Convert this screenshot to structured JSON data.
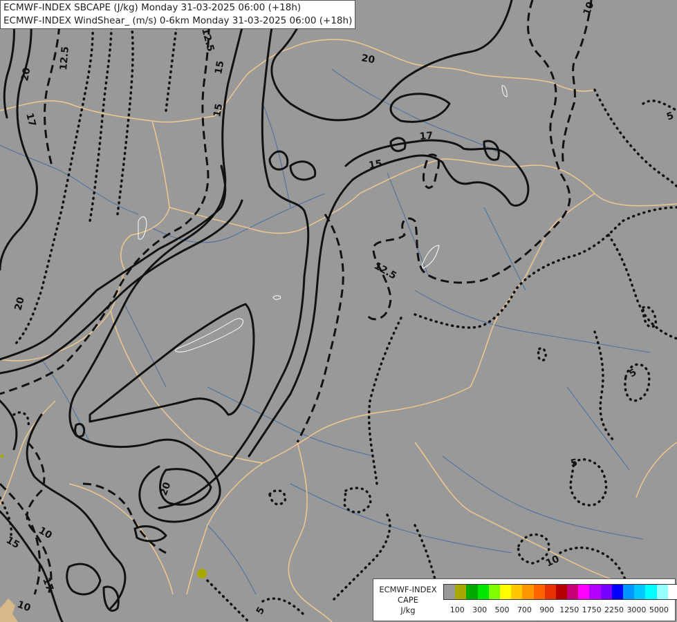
{
  "title": {
    "line1": "ECMWF-INDEX SBCAPE (J/kg) Monday 31-03-2025 06:00 (+18h)",
    "line2": "ECMWF-INDEX WindShear_ (m/s) 0-6km Monday 31-03-2025 06:00 (+18h)"
  },
  "legend": {
    "title_lines": [
      "ECMWF-INDEX",
      "CAPE",
      "J/kg"
    ],
    "colors": [
      "#999999",
      "#a8a800",
      "#00a800",
      "#00e600",
      "#80ff00",
      "#ffff00",
      "#ffc800",
      "#ff9600",
      "#ff6400",
      "#e63200",
      "#b40000",
      "#c80078",
      "#ff00ff",
      "#b400ff",
      "#7800ff",
      "#0000ff",
      "#0096ff",
      "#00c8ff",
      "#00ffff",
      "#96ffff",
      "#ffffff"
    ],
    "ticks": [
      "100",
      "300",
      "500",
      "700",
      "900",
      "1250",
      "1750",
      "2250",
      "3000",
      "5000"
    ]
  },
  "contour_labels": [
    "20",
    "12.5",
    "17",
    "12.5",
    "15",
    "20",
    "17",
    "15",
    "10",
    "12.5",
    "20",
    "15",
    "5",
    "5",
    "5",
    "10",
    "15",
    "10",
    "17",
    "10",
    "5",
    "20"
  ],
  "colors": {
    "background": "#999999",
    "borders": "#f0c890",
    "rivers": "#4a6e9c",
    "contours": "#111111",
    "cape_100": "#a8a800"
  }
}
